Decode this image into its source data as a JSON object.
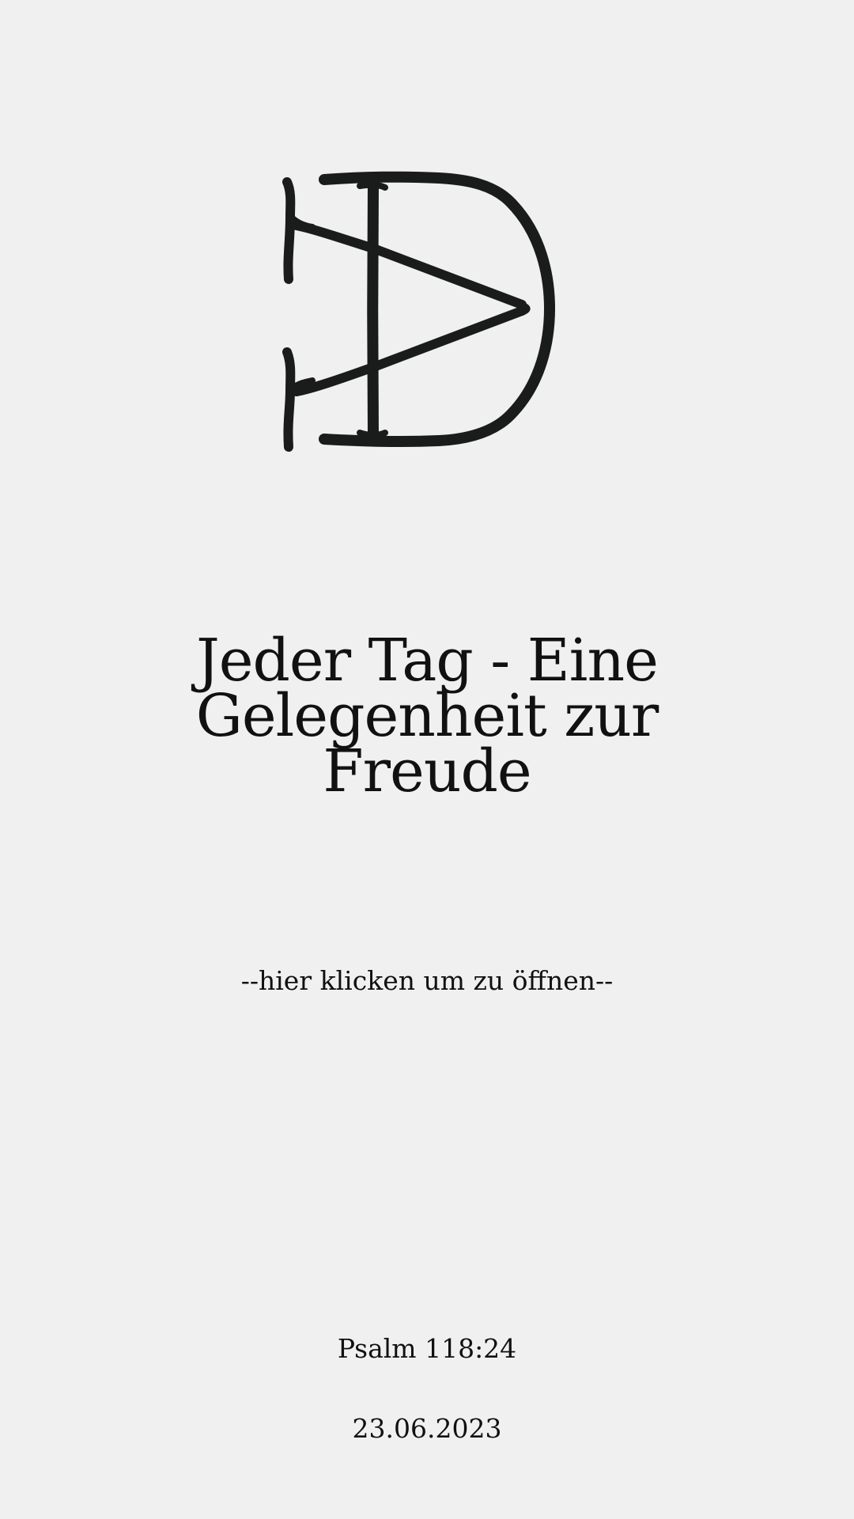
{
  "logo": {
    "icon": "d-monogram-logo",
    "color": "#1a1c1b"
  },
  "title": {
    "line1": "Jeder Tag - Eine",
    "line2": "Gelegenheit zur",
    "line3": "Freude"
  },
  "open_link": {
    "label": "--hier klicken um zu öffnen--"
  },
  "footer": {
    "reference": "Psalm 118:24",
    "date": "23.06.2023"
  },
  "colors": {
    "background": "#f0f0f0",
    "text": "#111111"
  }
}
